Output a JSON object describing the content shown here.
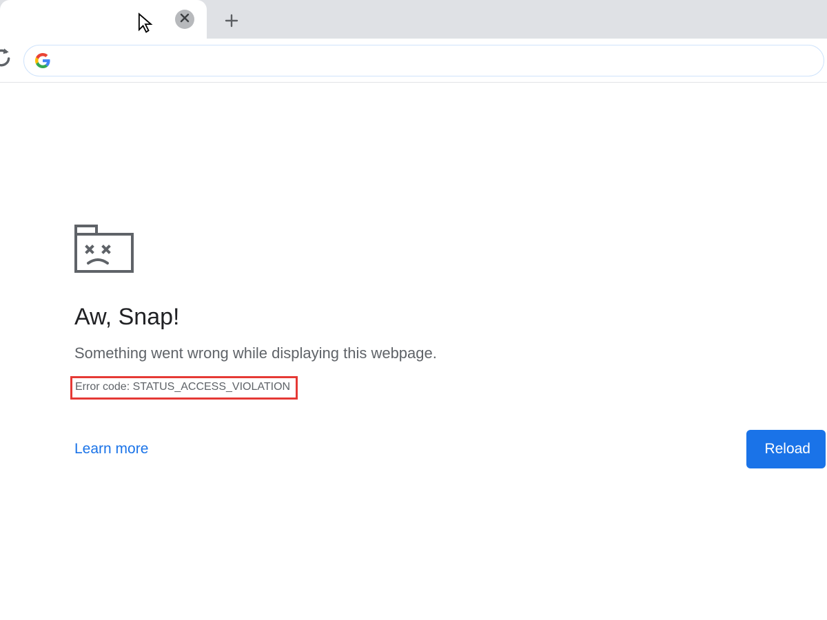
{
  "error": {
    "heading": "Aw, Snap!",
    "subtext": "Something went wrong while displaying this webpage.",
    "error_code": "Error code: STATUS_ACCESS_VIOLATION",
    "learn_more": "Learn more",
    "reload_button": "Reload"
  },
  "omnibox": {
    "value": ""
  }
}
